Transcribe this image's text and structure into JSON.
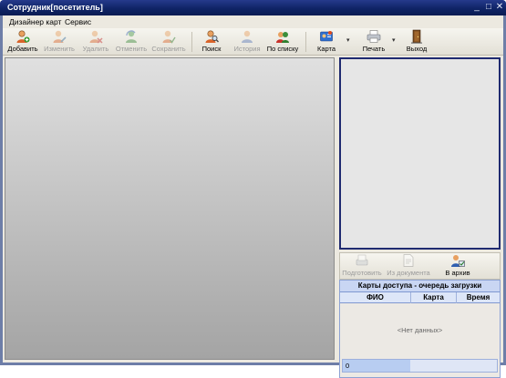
{
  "window": {
    "title": "Сотрудник[посетитель]"
  },
  "menu": [
    "Дизайнер карт",
    "Сервис"
  ],
  "toolbar": {
    "add": "Добавить",
    "edit": "Изменить",
    "delete": "Удалить",
    "cancel": "Отменить",
    "save": "Сохранить",
    "search": "Поиск",
    "history": "История",
    "by_list": "По списку",
    "card": "Карта",
    "print": "Печать",
    "exit": "Выход"
  },
  "right_toolbar": {
    "prepare": "Подготовить",
    "from_document": "Из документа",
    "to_archive": "В архив"
  },
  "queue": {
    "title": "Карты доступа - очередь загрузки",
    "columns": [
      "ФИО",
      "Карта",
      "Время"
    ],
    "empty_text": "<Нет данных>",
    "count": "0"
  }
}
